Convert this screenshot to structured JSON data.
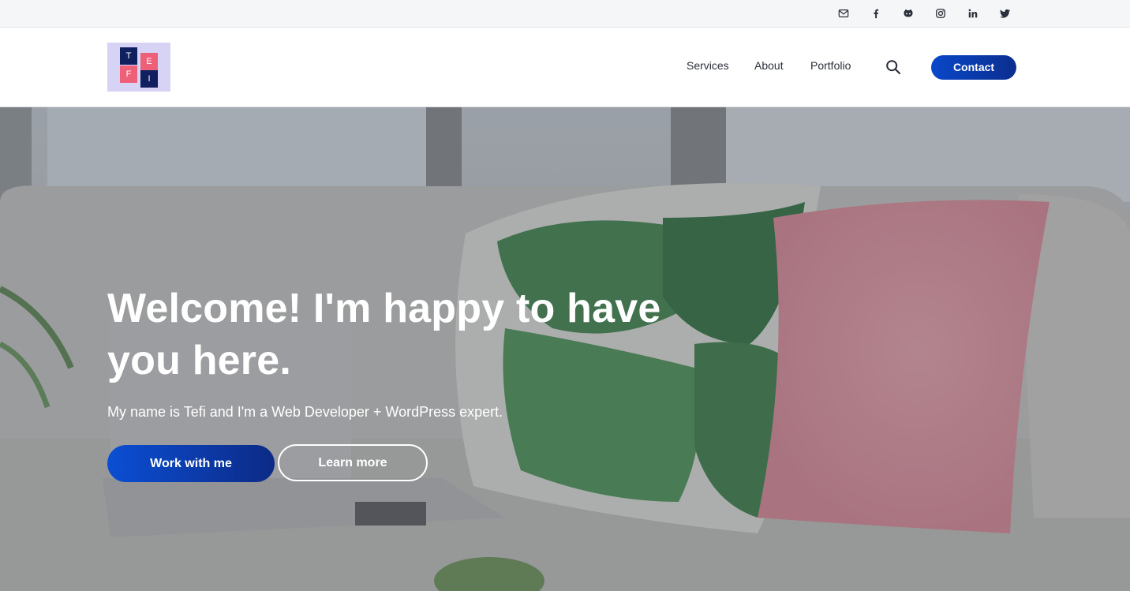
{
  "topbar": {
    "socials": [
      {
        "icon": "mail-icon",
        "label": "Email"
      },
      {
        "icon": "facebook-icon",
        "label": "Facebook"
      },
      {
        "icon": "github-icon",
        "label": "GitHub"
      },
      {
        "icon": "instagram-icon",
        "label": "Instagram"
      },
      {
        "icon": "linkedin-icon",
        "label": "LinkedIn"
      },
      {
        "icon": "twitter-icon",
        "label": "Twitter"
      }
    ]
  },
  "header": {
    "logo": {
      "letters": [
        "T",
        "E",
        "F",
        "I"
      ]
    },
    "nav": [
      {
        "label": "Services"
      },
      {
        "label": "About"
      },
      {
        "label": "Portfolio"
      }
    ],
    "search_icon": "search-icon",
    "contact_label": "Contact"
  },
  "hero": {
    "title": "Welcome! I'm happy to have you here.",
    "subtitle": "My name is Tefi and I'm a Web Developer + WordPress expert.",
    "primary_button": "Work with me",
    "secondary_button": "Learn more"
  },
  "colors": {
    "accent": "#0b4fd4",
    "accent_dark": "#0c2a86",
    "logo_bg": "#d6d3f4",
    "logo_navy": "#10205e",
    "logo_pink": "#ee5f78",
    "topbar_bg": "#f5f6f8"
  }
}
